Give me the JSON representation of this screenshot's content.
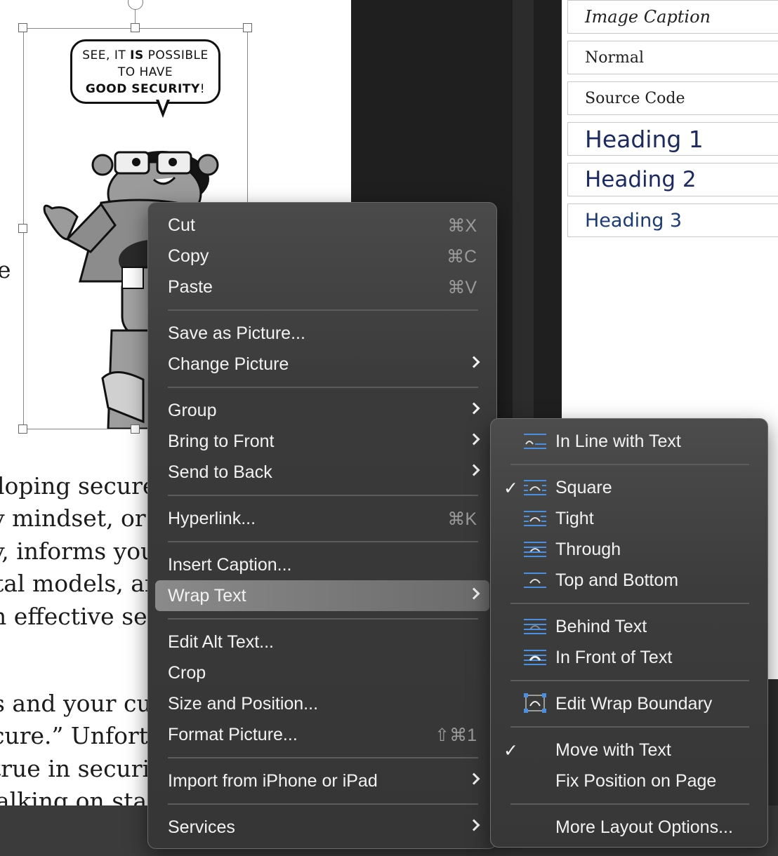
{
  "document": {
    "speech_bubble": {
      "line1": "SEE, IT",
      "line1_bold": "IS",
      "line1_end": "POSSIBLE",
      "line2": "TO HAVE",
      "line3": "GOOD SECURITY",
      "line3_end": "!"
    },
    "partial_char": "e",
    "body_lines": [
      "loping secure",
      "y mindset, or h",
      "y, informs you",
      "tal models, an",
      "n effective sec",
      "s and your cu",
      "cure.” Unfortu",
      "true in securi",
      "alking on stag"
    ]
  },
  "styles_pane": {
    "items": [
      {
        "label": "Image Caption"
      },
      {
        "label": "Normal"
      },
      {
        "label": "Source Code"
      },
      {
        "label": "Heading 1"
      },
      {
        "label": "Heading 2"
      },
      {
        "label": "Heading 3"
      }
    ]
  },
  "context_menu": {
    "cut": {
      "label": "Cut",
      "shortcut": "⌘X"
    },
    "copy": {
      "label": "Copy",
      "shortcut": "⌘C"
    },
    "paste": {
      "label": "Paste",
      "shortcut": "⌘V"
    },
    "save_as_picture": {
      "label": "Save as Picture..."
    },
    "change_picture": {
      "label": "Change Picture"
    },
    "group": {
      "label": "Group"
    },
    "bring_to_front": {
      "label": "Bring to Front"
    },
    "send_to_back": {
      "label": "Send to Back"
    },
    "hyperlink": {
      "label": "Hyperlink...",
      "shortcut": "⌘K"
    },
    "insert_caption": {
      "label": "Insert Caption..."
    },
    "wrap_text": {
      "label": "Wrap Text"
    },
    "edit_alt_text": {
      "label": "Edit Alt Text..."
    },
    "crop": {
      "label": "Crop"
    },
    "size_and_position": {
      "label": "Size and Position..."
    },
    "format_picture": {
      "label": "Format Picture...",
      "shortcut": "⇧⌘1"
    },
    "import_from_iphone": {
      "label": "Import from iPhone or iPad"
    },
    "services": {
      "label": "Services"
    }
  },
  "wrap_submenu": {
    "in_line": {
      "label": "In Line with Text",
      "icon": "wrap-inline-icon"
    },
    "square": {
      "label": "Square",
      "checked": "✓",
      "icon": "wrap-square-icon"
    },
    "tight": {
      "label": "Tight",
      "icon": "wrap-tight-icon"
    },
    "through": {
      "label": "Through",
      "icon": "wrap-through-icon"
    },
    "top_bottom": {
      "label": "Top and Bottom",
      "icon": "wrap-top-bottom-icon"
    },
    "behind": {
      "label": "Behind Text",
      "icon": "wrap-behind-icon"
    },
    "in_front": {
      "label": "In Front of Text",
      "icon": "wrap-in-front-icon"
    },
    "edit_boundary": {
      "label": "Edit Wrap Boundary",
      "icon": "edit-wrap-boundary-icon"
    },
    "move_with_text": {
      "label": "Move with Text",
      "checked": "✓"
    },
    "fix_position": {
      "label": "Fix Position on Page"
    },
    "more_layout": {
      "label": "More Layout Options..."
    }
  },
  "colors": {
    "menu_text": "#f2f2f2",
    "shortcut_text": "#9a9a9a",
    "heading_color": "#1b2a63",
    "icon_accent": "#4a90e2"
  }
}
